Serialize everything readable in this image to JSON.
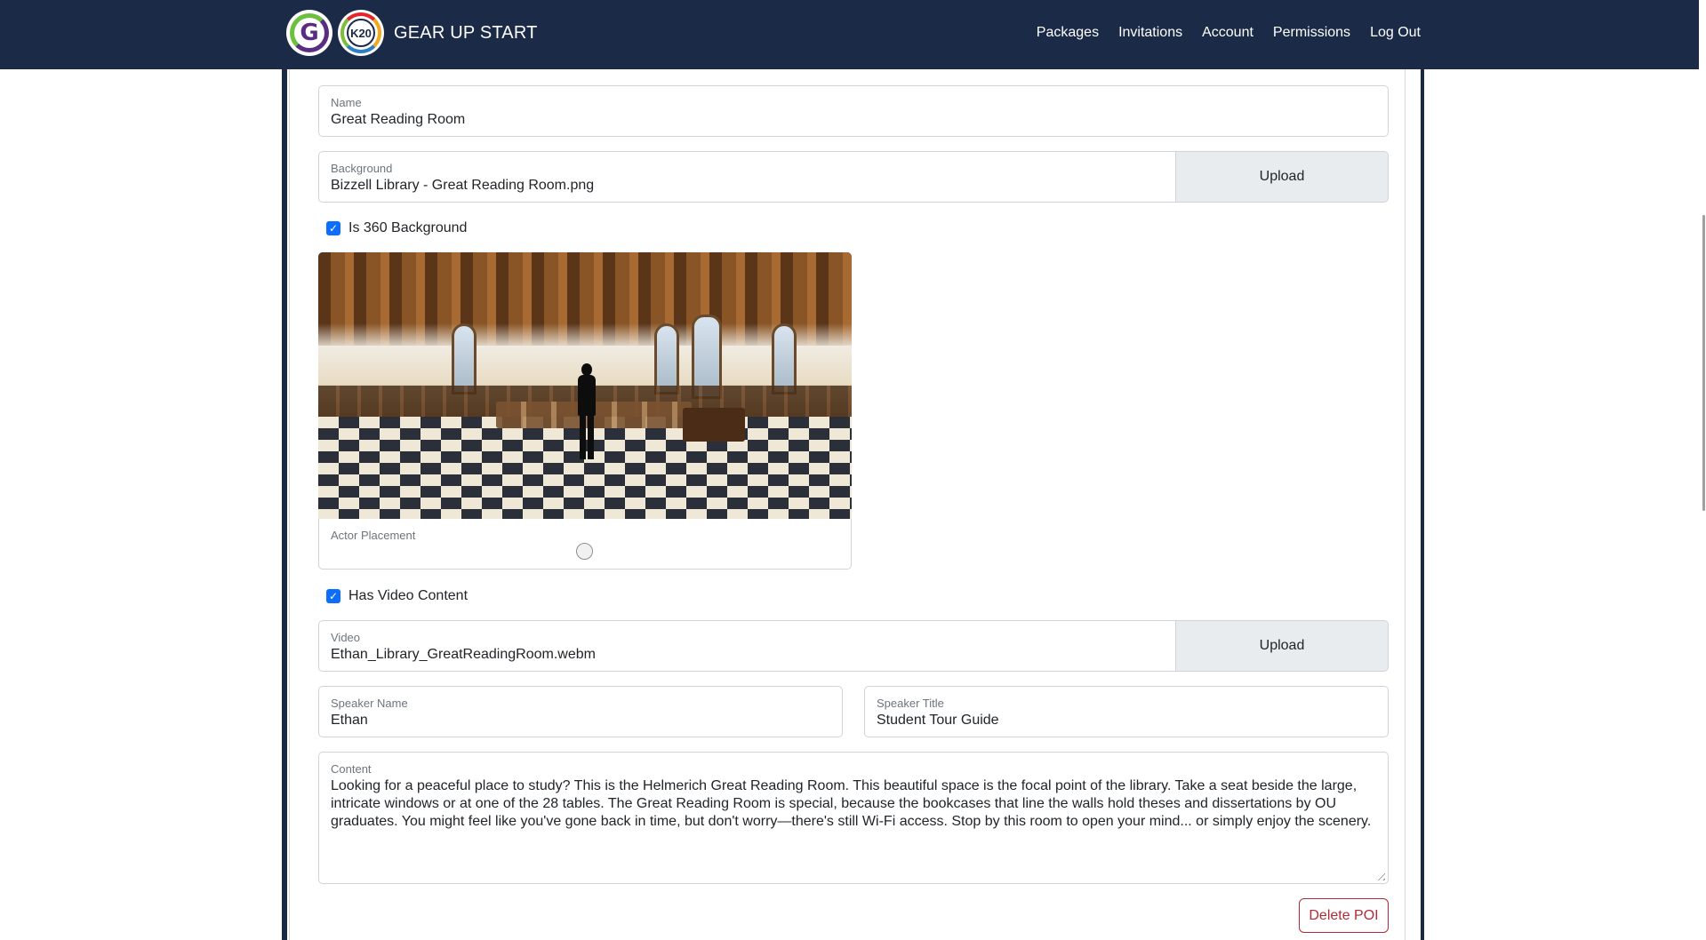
{
  "header": {
    "logo_g_letter": "G",
    "logo_k20_text": "K20",
    "brand": "GEAR UP START",
    "nav": [
      "Packages",
      "Invitations",
      "Account",
      "Permissions",
      "Log Out"
    ]
  },
  "form": {
    "name": {
      "label": "Name",
      "value": "Great Reading Room"
    },
    "background": {
      "label": "Background",
      "value": "Bizzell Library - Great Reading Room.png",
      "upload_label": "Upload"
    },
    "is360": {
      "label": "Is 360 Background",
      "checked": true
    },
    "actor_placement": {
      "label": "Actor Placement"
    },
    "has_video": {
      "label": "Has Video Content",
      "checked": true
    },
    "video": {
      "label": "Video",
      "value": "Ethan_Library_GreatReadingRoom.webm",
      "upload_label": "Upload"
    },
    "speaker_name": {
      "label": "Speaker Name",
      "value": "Ethan"
    },
    "speaker_title": {
      "label": "Speaker Title",
      "value": "Student Tour Guide"
    },
    "content": {
      "label": "Content",
      "value": "Looking for a peaceful place to study? This is the Helmerich Great Reading Room. This beautiful space is the focal point of the library. Take a seat beside the large, intricate windows or at one of the 28 tables. The Great Reading Room is special, because the bookcases that line the walls hold theses and dissertations by OU graduates. You might feel like you've gone back in time, but don't worry—there's still Wi-Fi access. Stop by this room to open your mind... or simply enjoy the scenery."
    },
    "delete_label": "Delete POI"
  },
  "colors": {
    "navbar": "#1b2a47",
    "checkbox": "#0d6efd",
    "danger": "#b02a37"
  }
}
